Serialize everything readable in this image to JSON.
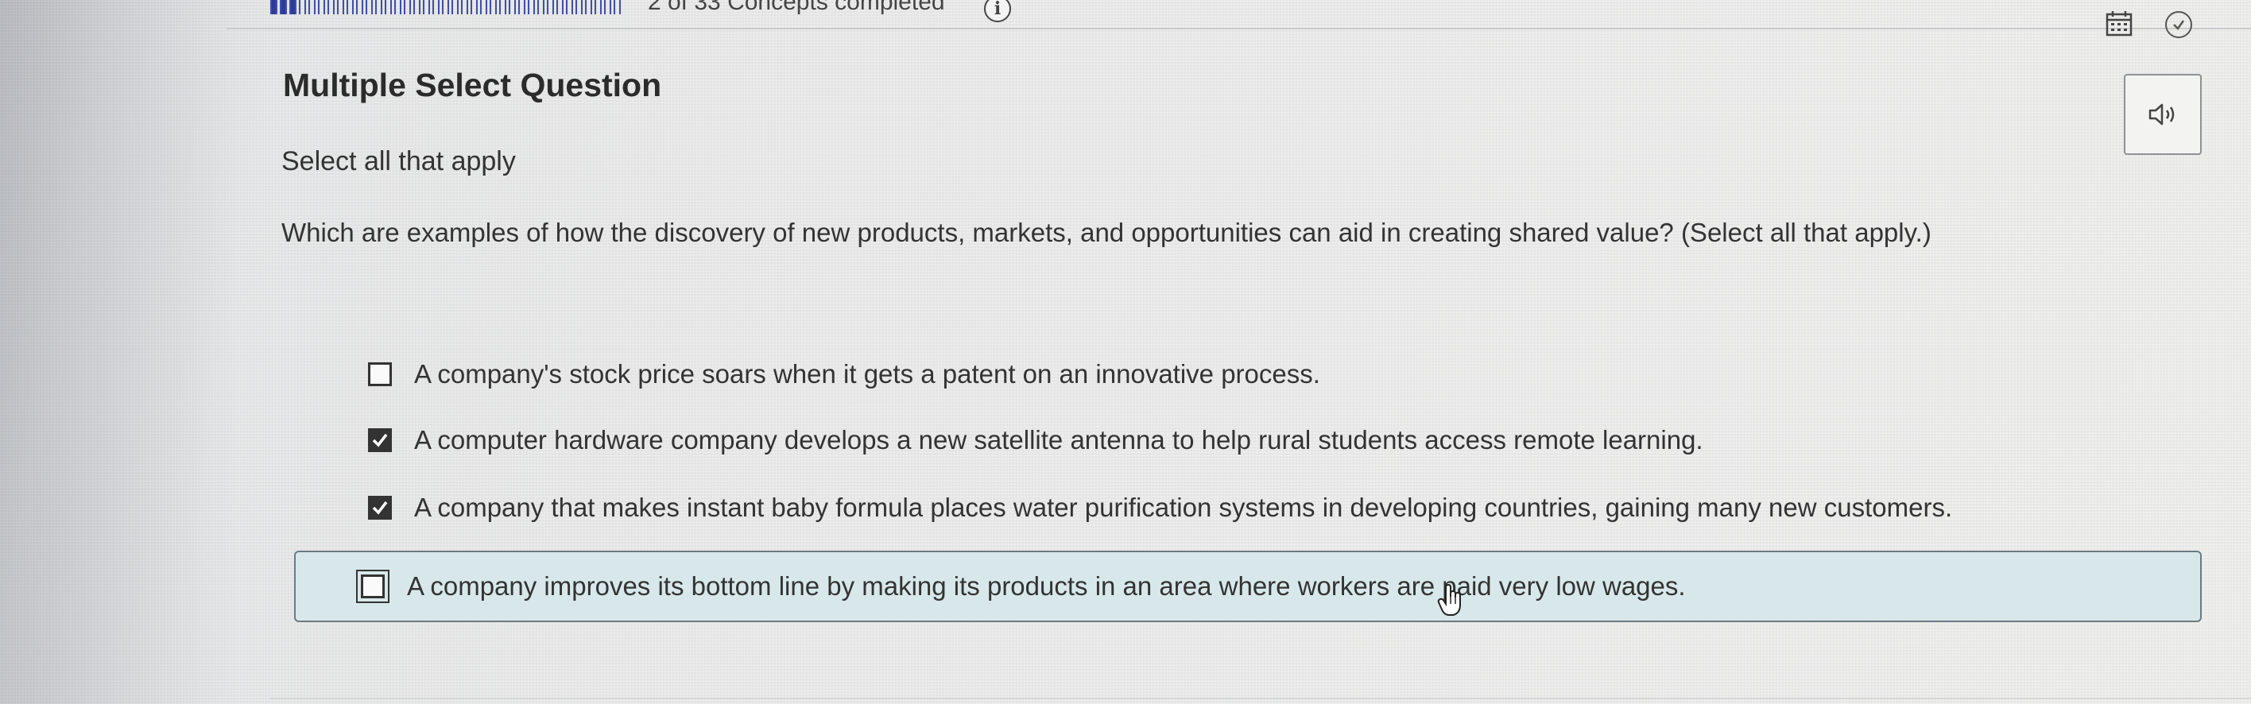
{
  "header": {
    "concepts_label": "2 of 33 Concepts completed",
    "info_icon": "info-icon",
    "calendar_icon": "calendar-icon",
    "check_icon": "check-circle-icon",
    "progress": {
      "completed": 2,
      "total": 33
    }
  },
  "question": {
    "title": "Multiple Select Question",
    "instruction": "Select all that apply",
    "prompt": "Which are examples of how the discovery of new products, markets, and opportunities can aid in creating shared value? (Select all that apply.)",
    "audio_icon": "speaker-icon"
  },
  "options": [
    {
      "label": "A company's stock price soars when it gets a patent on an innovative process.",
      "checked": false,
      "highlighted": false
    },
    {
      "label": "A computer hardware company develops a new satellite antenna to help rural students access remote learning.",
      "checked": true,
      "highlighted": false
    },
    {
      "label": "A company that makes instant baby formula places water purification systems in developing countries, gaining many new customers.",
      "checked": true,
      "highlighted": false
    },
    {
      "label": "A company improves its bottom line by making its products in an area where workers are paid very low wages.",
      "checked": false,
      "highlighted": true
    }
  ],
  "colors": {
    "progress_fill": "#2d3c9a",
    "highlight_bg": "#d8e8ea",
    "checkbox_checked": "#333333"
  }
}
